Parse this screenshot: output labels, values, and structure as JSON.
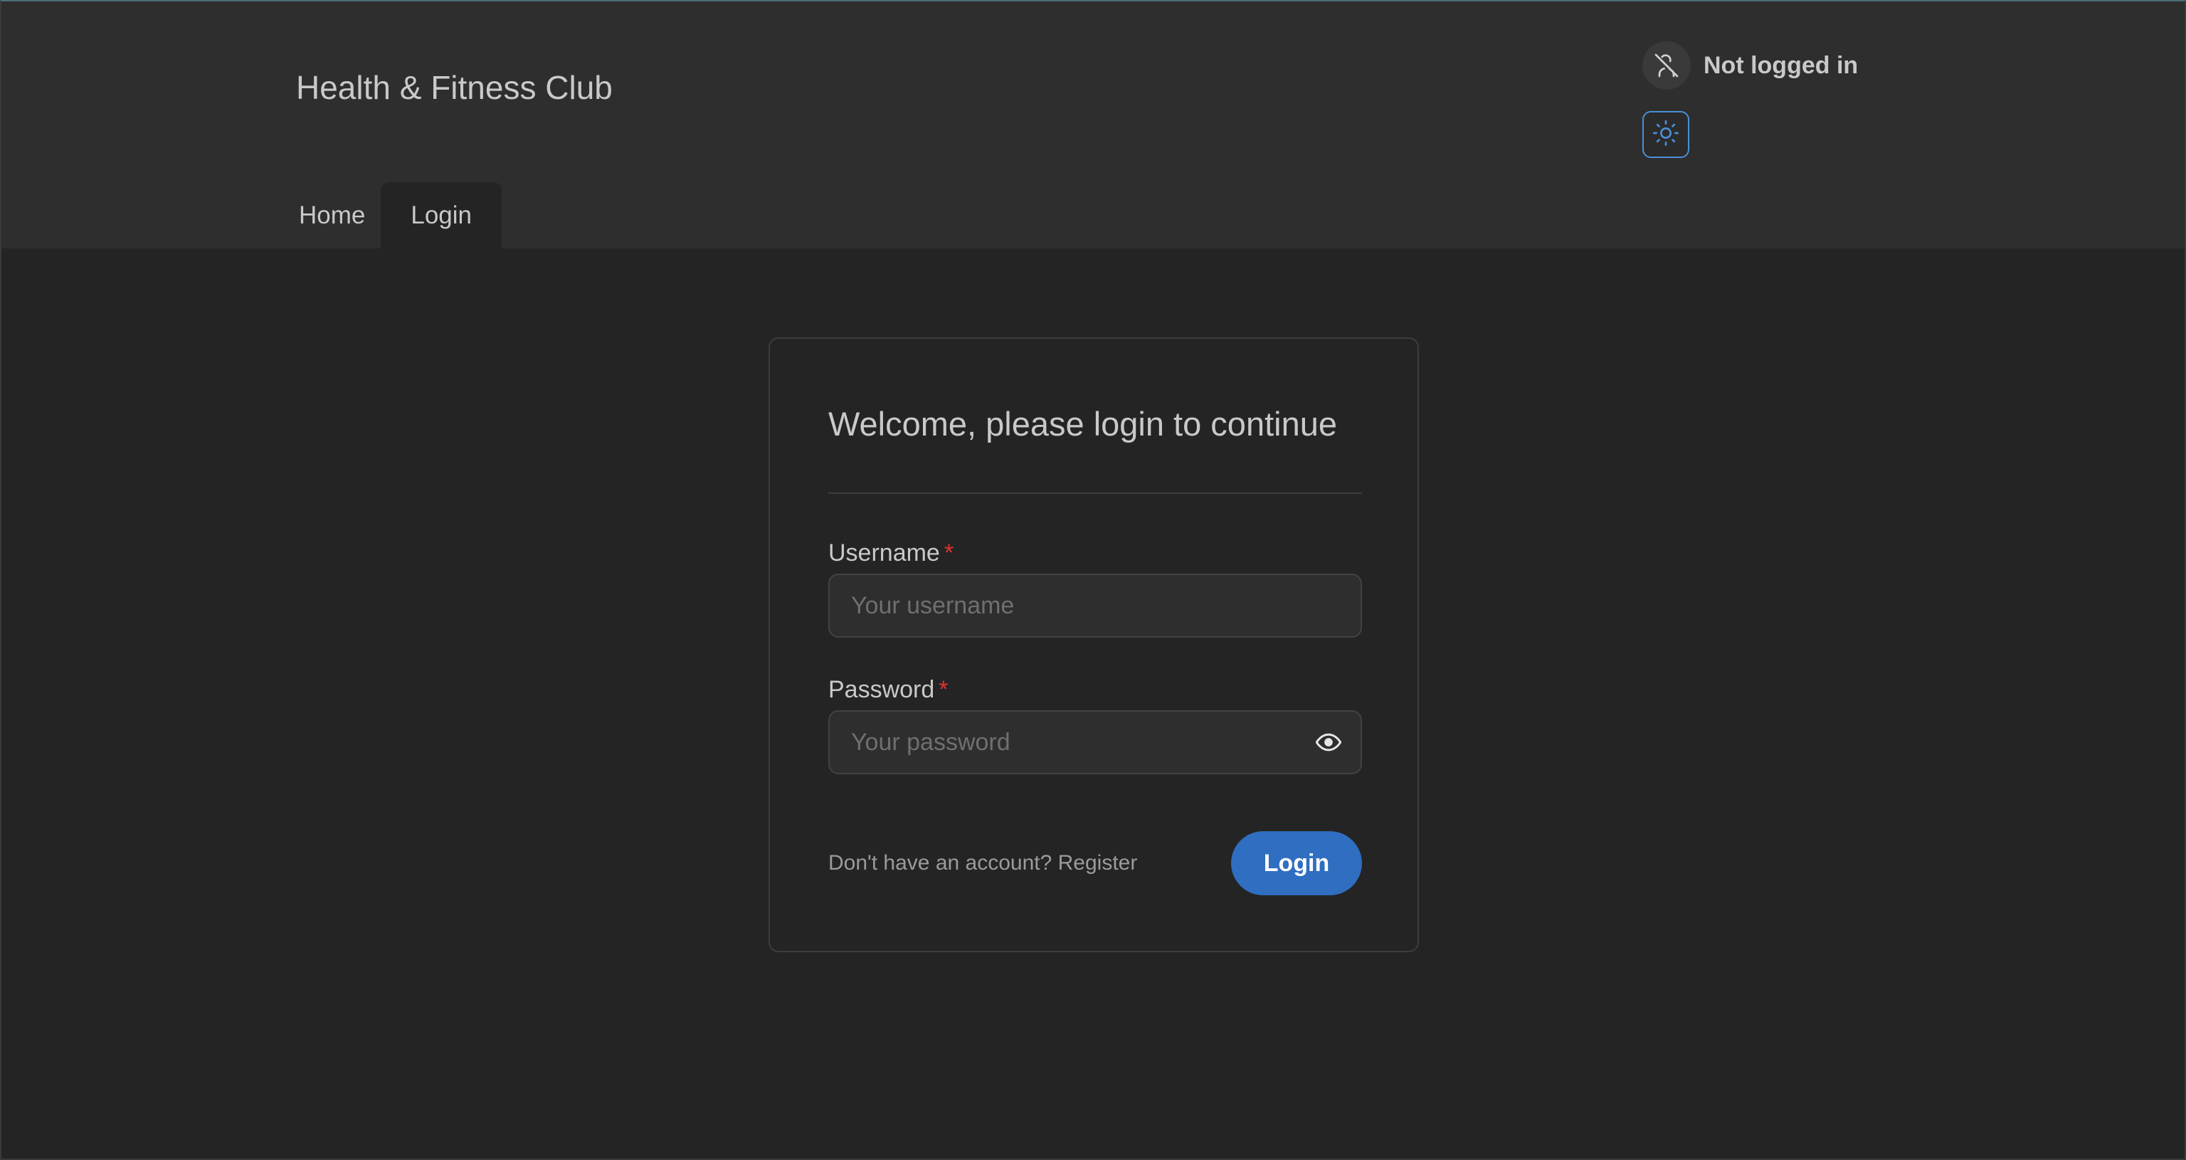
{
  "header": {
    "app_title": "Health & Fitness Club",
    "user_status": "Not logged in",
    "user_icon": "user-off-icon",
    "theme_icon": "sun-icon",
    "tabs": [
      {
        "label": "Home",
        "active": false
      },
      {
        "label": "Login",
        "active": true
      }
    ]
  },
  "login_card": {
    "title": "Welcome, please login to continue",
    "username": {
      "label": "Username",
      "required_marker": "*",
      "placeholder": "Your username",
      "value": ""
    },
    "password": {
      "label": "Password",
      "required_marker": "*",
      "placeholder": "Your password",
      "value": "",
      "toggle_icon": "eye-icon"
    },
    "register_text": "Don't have an account? Register",
    "login_button": "Login"
  },
  "colors": {
    "accent": "#2f6ec0",
    "required": "#e03131",
    "header_bg": "#2e2e2e",
    "page_bg": "#242424"
  }
}
